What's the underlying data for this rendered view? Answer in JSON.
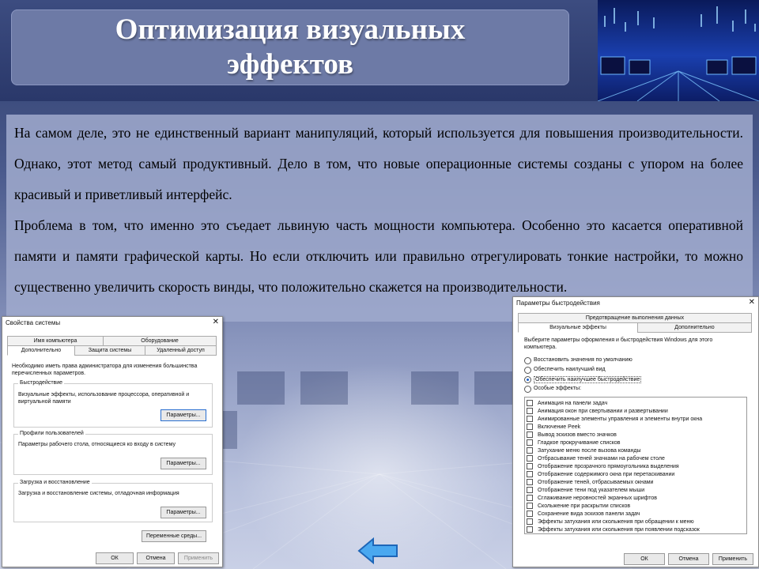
{
  "slide": {
    "title": "Оптимизация визуальных эффектов",
    "paragraphs": [
      "На самом деле, это не единственный вариант манипуляций, который используется для повышения производительности. Однако, этот метод самый продуктивный. Дело в том, что новые операционные системы созданы с упором на более красивый и приветливый интерфейс.",
      "Проблема в том, что именно это съедает львиную часть мощности компьютера. Особенно это касается оперативной памяти и памяти графической карты. Но если отключить или правильно отрегулировать тонкие настройки, то можно существенно увеличить скорость винды, что положительно скажется на производительности."
    ]
  },
  "system_properties": {
    "title": "Свойства системы",
    "close": "✕",
    "tabs_top": [
      "Имя компьютера",
      "Оборудование"
    ],
    "tabs_bottom": [
      "Дополнительно",
      "Защита системы",
      "Удаленный доступ"
    ],
    "admin_note": "Необходимо иметь права администратора для изменения большинства перечисленных параметров.",
    "performance": {
      "heading": "Быстродействие",
      "desc": "Визуальные эффекты, использование процессора, оперативной и виртуальной памяти",
      "button": "Параметры..."
    },
    "profiles": {
      "heading": "Профили пользователей",
      "desc": "Параметры рабочего стола, относящиеся ко входу в систему",
      "button": "Параметры..."
    },
    "startup": {
      "heading": "Загрузка и восстановление",
      "desc": "Загрузка и восстановление системы, отладочная информация",
      "button": "Параметры..."
    },
    "env_button": "Переменные среды...",
    "ok": "ОК",
    "cancel": "Отмена",
    "apply": "Применить"
  },
  "performance_options": {
    "title": "Параметры быстродействия",
    "close": "✕",
    "tabs_top": [
      "Предотвращение выполнения данных"
    ],
    "tabs_bottom": [
      "Визуальные эффекты",
      "Дополнительно"
    ],
    "intro": "Выберите параметры оформления и быстродействия Windows для этого компьютера.",
    "radios": [
      {
        "label": "Восстановить значения по умолчанию",
        "selected": false
      },
      {
        "label": "Обеспечить наилучший вид",
        "selected": false
      },
      {
        "label": "Обеспечить наилучшее быстродействие",
        "selected": true
      },
      {
        "label": "Особые эффекты:",
        "selected": false
      }
    ],
    "effects": [
      "Анимация на панели задач",
      "Анимация окон при свертывании и развертывании",
      "Анимированные элементы управления и элементы внутри окна",
      "Включение Peek",
      "Вывод эскизов вместо значков",
      "Гладкое прокручивание списков",
      "Затухание меню после вызова команды",
      "Отбрасывание теней значками на рабочем столе",
      "Отображение прозрачного прямоугольника выделения",
      "Отображение содержимого окна при перетаскивании",
      "Отображение теней, отбрасываемых окнами",
      "Отображение тени под указателем мыши",
      "Сглаживание неровностей экранных шрифтов",
      "Скольжение при раскрытии списков",
      "Сохранение вида эскизов панели задач",
      "Эффекты затухания или скольжения при обращении к меню",
      "Эффекты затухания или скольжения при появлении подсказок"
    ],
    "ok": "ОК",
    "cancel": "Отмена",
    "apply": "Применить"
  },
  "nav": {
    "back_arrow": "back-arrow-icon"
  }
}
